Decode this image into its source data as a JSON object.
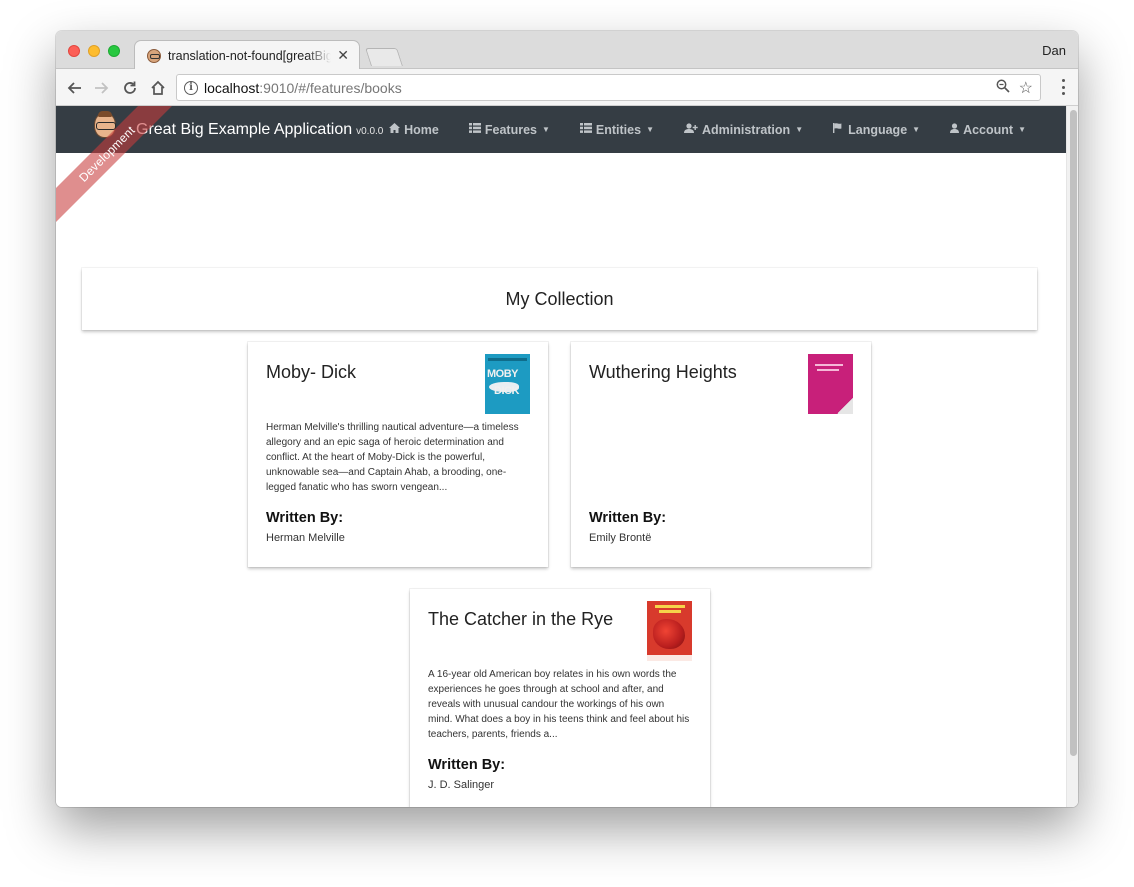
{
  "browser": {
    "tab_title": "translation-not-found[greatBig",
    "profile_name": "Dan",
    "url_host": "localhost",
    "url_rest": ":9010/#/features/books"
  },
  "app": {
    "brand_title": "Great Big Example Application",
    "brand_version": "v0.0.0",
    "ribbon": "Development",
    "nav": [
      {
        "label": "Home",
        "icon": "home-icon",
        "dropdown": false
      },
      {
        "label": "Features",
        "icon": "list-icon",
        "dropdown": true
      },
      {
        "label": "Entities",
        "icon": "list-icon",
        "dropdown": true
      },
      {
        "label": "Administration",
        "icon": "user-plus-icon",
        "dropdown": true
      },
      {
        "label": "Language",
        "icon": "flag-icon",
        "dropdown": true
      },
      {
        "label": "Account",
        "icon": "user-icon",
        "dropdown": true
      }
    ]
  },
  "page": {
    "collection_title": "My Collection",
    "written_by_label": "Written By:",
    "books": [
      {
        "title": "Moby- Dick",
        "description": "Herman Melville's thrilling nautical adventure—a timeless allegory and an epic saga of heroic determination and conflict. At the heart of Moby-Dick is the powerful, unknowable sea—and Captain Ahab, a brooding, one-legged fanatic who has sworn vengean...",
        "author": "Herman Melville",
        "cover_color": "#1d9bc2"
      },
      {
        "title": "Wuthering Heights",
        "description": "",
        "author": "Emily Brontë",
        "cover_color": "#c8207a"
      },
      {
        "title": "The Catcher in the Rye",
        "description": "A 16-year old American boy relates in his own words the experiences he goes through at school and after, and reveals with unusual candour the workings of his own mind. What does a boy in his teens think and feel about his teachers, parents, friends a...",
        "author": "J. D. Salinger",
        "cover_color": "#d83a2c"
      }
    ]
  }
}
